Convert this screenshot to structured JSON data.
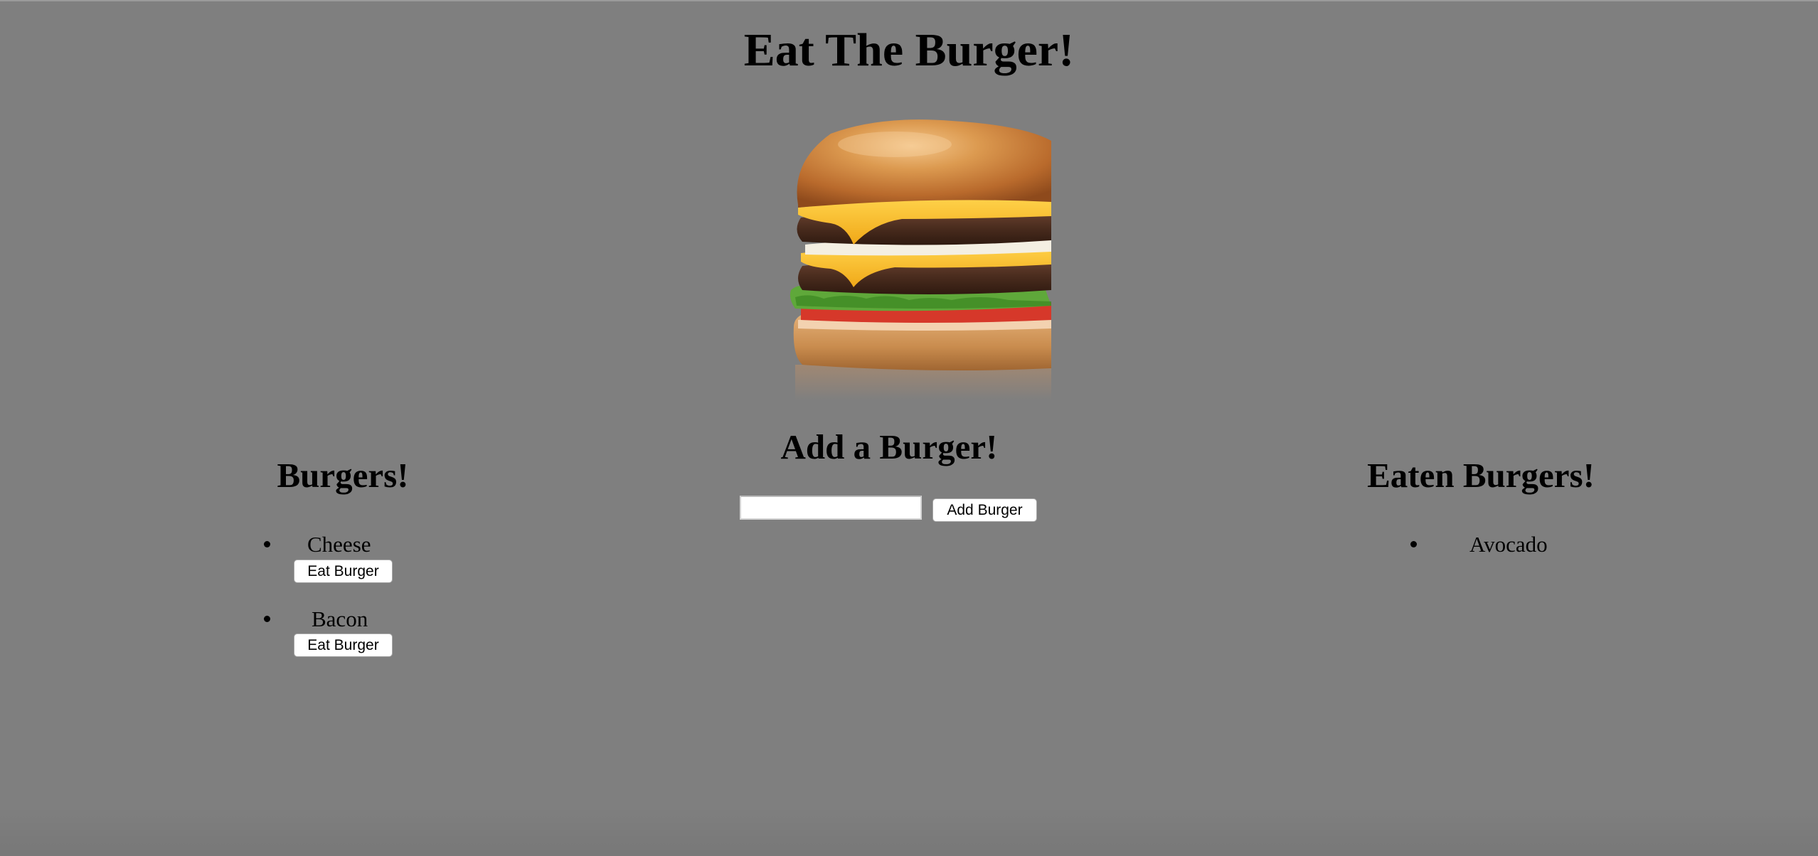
{
  "header": {
    "title": "Eat The Burger!"
  },
  "add_section": {
    "title": "Add a Burger!",
    "input_value": "",
    "input_placeholder": "",
    "add_button_label": "Add Burger"
  },
  "burgers": {
    "title": "Burgers!",
    "items": [
      {
        "name": "Cheese",
        "button_label": "Eat Burger"
      },
      {
        "name": "Bacon",
        "button_label": "Eat Burger"
      }
    ]
  },
  "eaten": {
    "title": "Eaten Burgers!",
    "items": [
      {
        "name": "Avocado"
      }
    ]
  },
  "colors": {
    "background": "#7f7f7f",
    "button_background": "#ffffff"
  }
}
